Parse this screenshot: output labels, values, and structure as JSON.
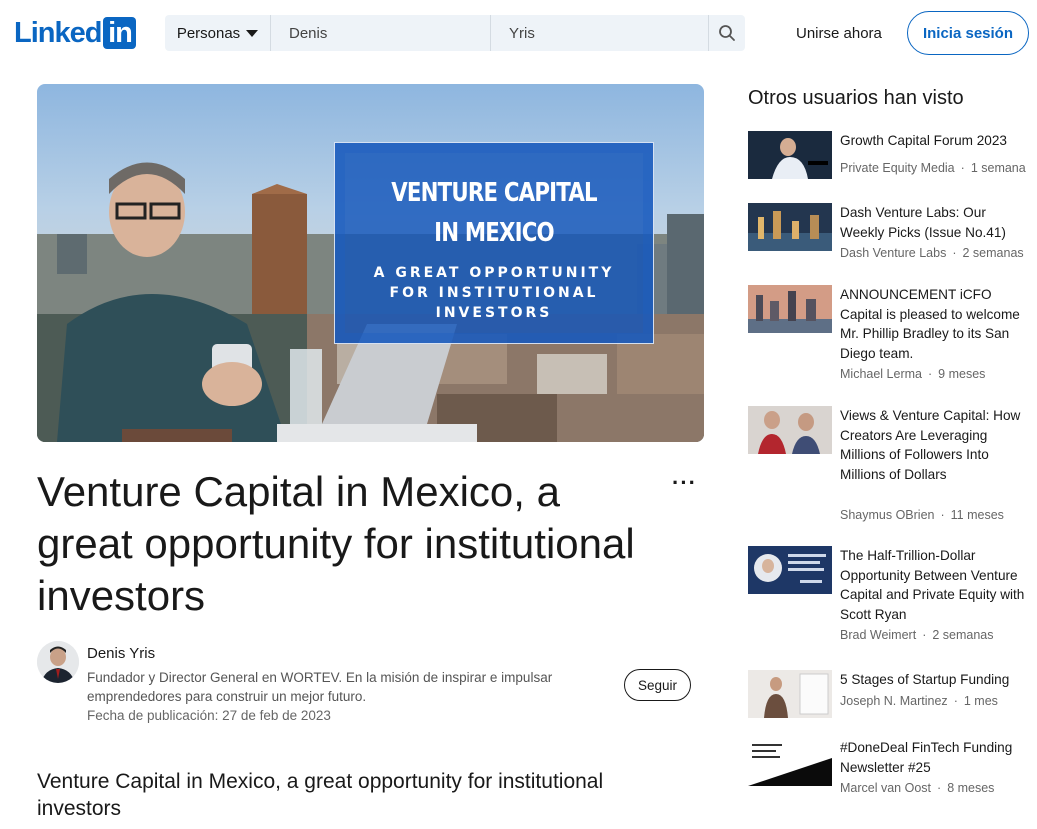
{
  "brand": {
    "logo_word": "Linked",
    "logo_box": "in"
  },
  "search": {
    "category": "Personas",
    "first_name": "Denis",
    "last_name": "Yris"
  },
  "header": {
    "join_label": "Unirse ahora",
    "signin_label": "Inicia sesión"
  },
  "hero": {
    "line1": "VENTURE CAPITAL",
    "line2": "IN MEXICO",
    "line3": "A GREAT OPPORTUNITY\nFOR INSTITUTIONAL\nINVESTORS"
  },
  "article": {
    "title": "Venture Capital in Mexico, a great opportunity for institutional investors",
    "more_label": "···",
    "author": "Denis Yris",
    "bio": "Fundador y Director General en WORTEV. En la misión de inspirar e impulsar emprendedores para construir un mejor futuro.",
    "published": "Fecha de publicación: 27 de feb de 2023",
    "follow_label": "Seguir",
    "subtitle": "Venture Capital in Mexico, a great opportunity for institutional investors"
  },
  "sidebar": {
    "heading": "Otros usuarios han visto",
    "items": [
      {
        "title": "Growth Capital Forum 2023",
        "author": "Private Equity Media",
        "time": "1 semana"
      },
      {
        "title": "Dash Venture Labs: Our Weekly Picks (Issue No.41)",
        "author": "Dash Venture Labs",
        "time": "2 semanas"
      },
      {
        "title": "ANNOUNCEMENT iCFO Capital is pleased to welcome Mr. Phillip Bradley to its San Diego team.",
        "author": "Michael Lerma",
        "time": "9 meses"
      },
      {
        "title": "Views & Venture Capital: How Creators Are Leveraging Millions of Followers Into Millions of Dollars",
        "author": "Shaymus OBrien",
        "time": "11 meses"
      },
      {
        "title": "The Half-Trillion-Dollar Opportunity Between Venture Capital and Private Equity with Scott Ryan",
        "author": "Brad Weimert",
        "time": "2 semanas"
      },
      {
        "title": "5 Stages of Startup Funding",
        "author": "Joseph N. Martinez",
        "time": "1 mes"
      },
      {
        "title": "#DoneDeal FinTech Funding Newsletter #25",
        "author": "Marcel van Oost",
        "time": "8 meses"
      }
    ]
  }
}
